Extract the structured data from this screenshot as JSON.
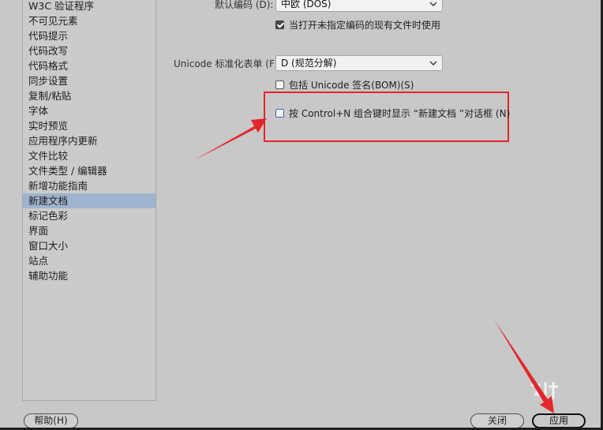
{
  "sidebar": {
    "items": [
      {
        "label": "W3C 验证程序"
      },
      {
        "label": "不可见元素"
      },
      {
        "label": "代码提示"
      },
      {
        "label": "代码改写"
      },
      {
        "label": "代码格式"
      },
      {
        "label": "同步设置"
      },
      {
        "label": "复制/粘贴"
      },
      {
        "label": "字体"
      },
      {
        "label": "实时预览"
      },
      {
        "label": "应用程序内更新"
      },
      {
        "label": "文件比较"
      },
      {
        "label": "文件类型 / 编辑器"
      },
      {
        "label": "新增功能指南"
      },
      {
        "label": "新建文档"
      },
      {
        "label": "标记色彩"
      },
      {
        "label": "界面"
      },
      {
        "label": "窗口大小"
      },
      {
        "label": "站点"
      },
      {
        "label": "辅助功能"
      }
    ],
    "selected_index": 13
  },
  "settings": {
    "default_encoding": {
      "label": "默认编码 (D):",
      "value": "中欧 (DOS)"
    },
    "use_when_opening": {
      "label": "当打开未指定编码的现有文件时使用",
      "checked": true
    },
    "unicode_normalization": {
      "label": "Unicode 标准化表单 (F):",
      "value": "D (规范分解)"
    },
    "include_bom": {
      "label": "包括 Unicode 签名(BOM)(S)",
      "checked": false
    },
    "show_new_doc_dialog": {
      "label": "按 Control+N 组合键时显示 “新建文档 ”对话框 (N)",
      "checked": false
    }
  },
  "footer": {
    "help_label": "帮助(H)",
    "close_label": "关闭",
    "apply_label": "应用"
  },
  "colors": {
    "annotation_red": "#e3262b",
    "selection": "#9fb4cf",
    "background": "#c8c8c8"
  }
}
